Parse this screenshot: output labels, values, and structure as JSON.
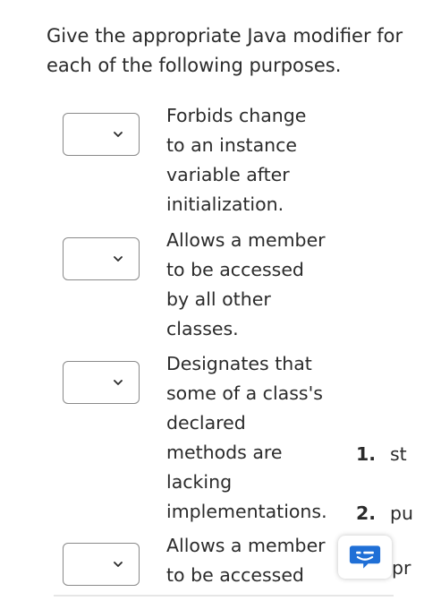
{
  "question": {
    "text": "Give the appropriate Java modifier for each of the following purposes."
  },
  "items": [
    {
      "description": "Forbids change to an instance variable after initialization."
    },
    {
      "description": "Allows a member to be accessed by all other classes."
    },
    {
      "description": "Designates that some of a class's declared methods are lacking implementations."
    },
    {
      "description": "Allows a member to be accessed"
    }
  ],
  "options_list": [
    {
      "number": "1.",
      "text": "st"
    },
    {
      "number": "2.",
      "text": "pu"
    }
  ],
  "peek_text": "pr",
  "colors": {
    "text": "#2b2b2b",
    "border": "#8a8a8a",
    "chat_icon": "#1f6fd6"
  },
  "icons": {
    "dropdown": "chevron-down-icon",
    "chat": "chat-bubble-icon"
  }
}
